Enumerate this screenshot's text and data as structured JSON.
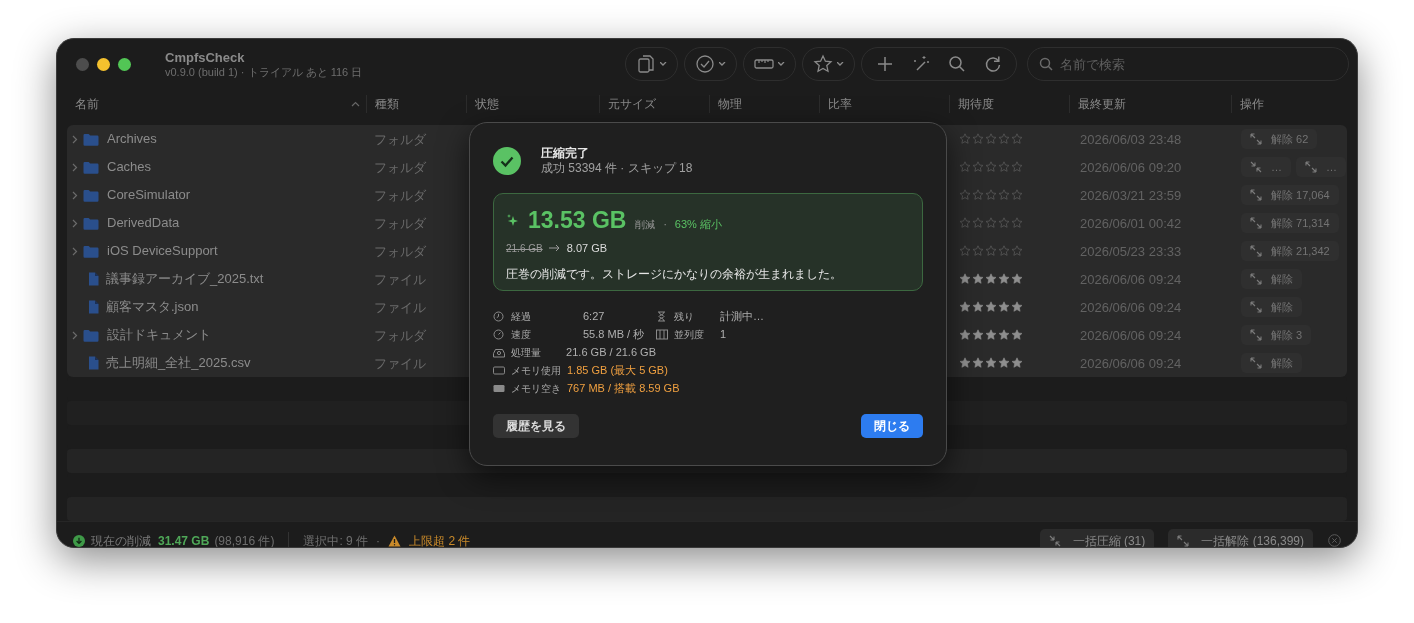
{
  "app": {
    "title": "CmpfsCheck",
    "subtitle": "v0.9.0 (build 1) · トライアル あと 116 日"
  },
  "search": {
    "placeholder": "名前で検索"
  },
  "columns": [
    {
      "label": "名前",
      "sorted": true
    },
    {
      "label": "種類",
      "sorted": false
    },
    {
      "label": "状態",
      "sorted": false
    },
    {
      "label": "元サイズ",
      "sorted": false
    },
    {
      "label": "物理",
      "sorted": false
    },
    {
      "label": "比率",
      "sorted": false
    },
    {
      "label": "期待度",
      "sorted": false
    },
    {
      "label": "最終更新",
      "sorted": false
    },
    {
      "label": "操作",
      "sorted": false
    }
  ],
  "rows": [
    {
      "kind": "folder",
      "name": "Archives",
      "type": "フォルダ",
      "stars": 0,
      "modified": "2026/06/03 23:48",
      "selected": true,
      "actions": [
        {
          "kind": "expand",
          "label": "解除 62"
        }
      ]
    },
    {
      "kind": "folder",
      "name": "Caches",
      "type": "フォルダ",
      "stars": 0,
      "modified": "2026/06/06 09:20",
      "selected": true,
      "actions": [
        {
          "kind": "compress",
          "label": "…"
        },
        {
          "kind": "expand",
          "label": "…"
        }
      ]
    },
    {
      "kind": "folder",
      "name": "CoreSimulator",
      "type": "フォルダ",
      "stars": 0,
      "modified": "2026/03/21 23:59",
      "selected": true,
      "actions": [
        {
          "kind": "expand",
          "label": "解除 17,064"
        }
      ]
    },
    {
      "kind": "folder",
      "name": "DerivedData",
      "type": "フォルダ",
      "stars": 0,
      "modified": "2026/06/01 00:42",
      "selected": true,
      "actions": [
        {
          "kind": "expand",
          "label": "解除 71,314"
        }
      ]
    },
    {
      "kind": "folder",
      "name": "iOS DeviceSupport",
      "type": "フォルダ",
      "stars": 0,
      "modified": "2026/05/23 23:33",
      "selected": true,
      "actions": [
        {
          "kind": "expand",
          "label": "解除 21,342"
        }
      ]
    },
    {
      "kind": "file",
      "name": "議事録アーカイブ_2025.txt",
      "type": "ファイル",
      "stars": 5,
      "modified": "2026/06/06 09:24",
      "selected": true,
      "actions": [
        {
          "kind": "expand",
          "label": "解除"
        }
      ]
    },
    {
      "kind": "file",
      "name": "顧客マスタ.json",
      "type": "ファイル",
      "stars": 5,
      "modified": "2026/06/06 09:24",
      "selected": true,
      "actions": [
        {
          "kind": "expand",
          "label": "解除"
        }
      ]
    },
    {
      "kind": "folder",
      "name": "設計ドキュメント",
      "type": "フォルダ",
      "stars": 5,
      "modified": "2026/06/06 09:24",
      "selected": true,
      "actions": [
        {
          "kind": "expand",
          "label": "解除 3"
        }
      ]
    },
    {
      "kind": "file",
      "name": "売上明細_全社_2025.csv",
      "type": "ファイル",
      "stars": 5,
      "modified": "2026/06/06 09:24",
      "selected": true,
      "actions": [
        {
          "kind": "expand",
          "label": "解除"
        }
      ]
    }
  ],
  "dialog": {
    "title": "圧縮完了",
    "subtitle": "成功 53394 件 · スキップ 18",
    "saved": "13.53 GB",
    "saved_label": "削減",
    "dot": "·",
    "ratio": "63% 縮小",
    "before": "21.6 GB",
    "after": "8.07 GB",
    "message": "圧巻の削減です。ストレージにかなりの余裕が生まれました。",
    "stats": [
      [
        {
          "kind": "clock",
          "label": "経過",
          "value": "6:27",
          "highlight": false
        },
        {
          "kind": "hourglass",
          "label": "残り",
          "value": "計測中…",
          "highlight": false
        }
      ],
      [
        {
          "kind": "gauge",
          "label": "速度",
          "value": "55.8 MB / 秒",
          "highlight": false
        },
        {
          "kind": "columns",
          "label": "並列度",
          "value": "1",
          "highlight": false
        }
      ],
      [
        {
          "kind": "drive",
          "label": "処理量",
          "value": "21.6 GB / 21.6 GB",
          "highlight": false
        }
      ],
      [
        {
          "kind": "memory",
          "label": "メモリ使用",
          "value": "1.85 GB (最大 5 GB)",
          "highlight": true
        }
      ],
      [
        {
          "kind": "chip",
          "label": "メモリ空き",
          "value": "767 MB / 搭載 8.59 GB",
          "highlight": true
        }
      ]
    ],
    "buttons": [
      {
        "label": "履歴を見る",
        "primary": false
      },
      {
        "label": "閉じる",
        "primary": true
      }
    ]
  },
  "status_bar": {
    "saved_label": "現在の削減",
    "saved_value": "31.47 GB",
    "saved_count": "(98,916 件)",
    "selection": "選択中: 9 件",
    "dot": "·",
    "warning": "上限超 2 件",
    "buttons": [
      {
        "kind": "compress",
        "label": "一括圧縮 (31)"
      },
      {
        "kind": "expand",
        "label": "一括解除 (136,399)"
      }
    ]
  }
}
